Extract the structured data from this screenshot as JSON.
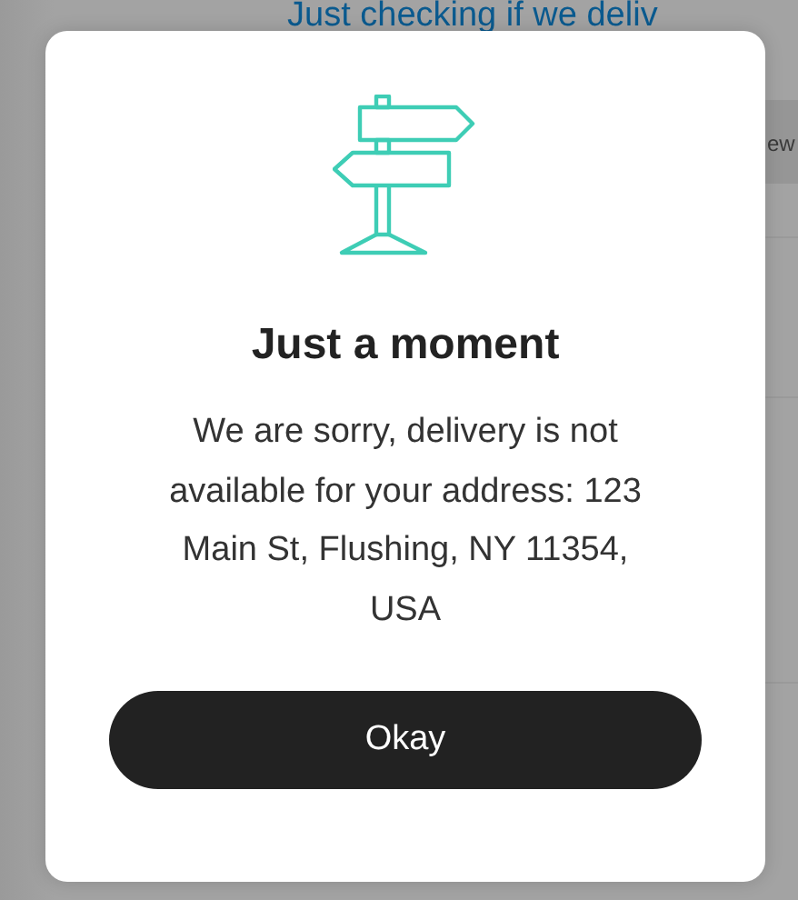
{
  "background": {
    "heading": "Just checking if we deliv",
    "tab_text": "ew"
  },
  "dialog": {
    "title": "Just a moment",
    "message": "We are sorry, delivery is not available for your address: 123 Main St, Flushing, NY 11354, USA",
    "button": "Okay"
  }
}
